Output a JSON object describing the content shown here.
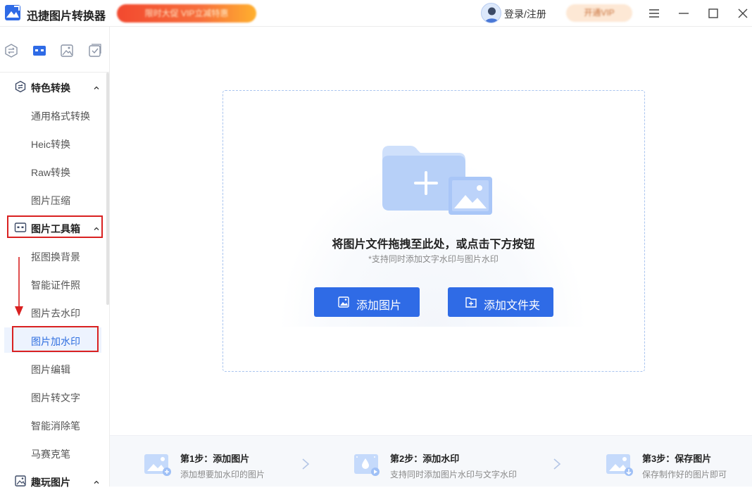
{
  "app": {
    "title": "迅捷图片转换器",
    "promo_text": "限时大促 VIP立减特惠",
    "login_label": "登录/注册",
    "vip_label": "开通VIP",
    "icons": {
      "logo": "app-logo-icon",
      "menu": "menu-icon",
      "minimize": "minimize-icon",
      "maximize": "maximize-icon",
      "close": "close-icon"
    }
  },
  "sidebar": {
    "top_icons": [
      "convert-icon",
      "toolbox-icon",
      "image-fun-icon",
      "checklist-icon"
    ],
    "groups": [
      {
        "label": "特色转换",
        "icon": "convert-icon",
        "expanded": true,
        "items": [
          "通用格式转换",
          "Heic转换",
          "Raw转换",
          "图片压缩"
        ]
      },
      {
        "label": "图片工具箱",
        "icon": "toolbox-icon",
        "expanded": true,
        "items": [
          "抠图换背景",
          "智能证件照",
          "图片去水印",
          "图片加水印",
          "图片编辑",
          "图片转文字",
          "智能消除笔",
          "马赛克笔"
        ]
      },
      {
        "label": "趣玩图片",
        "icon": "image-fun-icon",
        "expanded": true,
        "items": []
      }
    ],
    "active_item": "图片加水印"
  },
  "main": {
    "drop_title": "将图片文件拖拽至此处，或点击下方按钮",
    "drop_subtitle": "*支持同时添加文字水印与图片水印",
    "buttons": {
      "add_image": "添加图片",
      "add_folder": "添加文件夹"
    },
    "steps": [
      {
        "title": "第1步：添加图片",
        "desc": "添加想要加水印的图片"
      },
      {
        "title": "第2步：添加水印",
        "desc": "支持同时添加图片水印与文字水印"
      },
      {
        "title": "第3步：保存图片",
        "desc": "保存制作好的图片即可"
      }
    ]
  },
  "colors": {
    "accent": "#2f6be6",
    "annotation_red": "#d92121",
    "promo": "#f2492f"
  }
}
